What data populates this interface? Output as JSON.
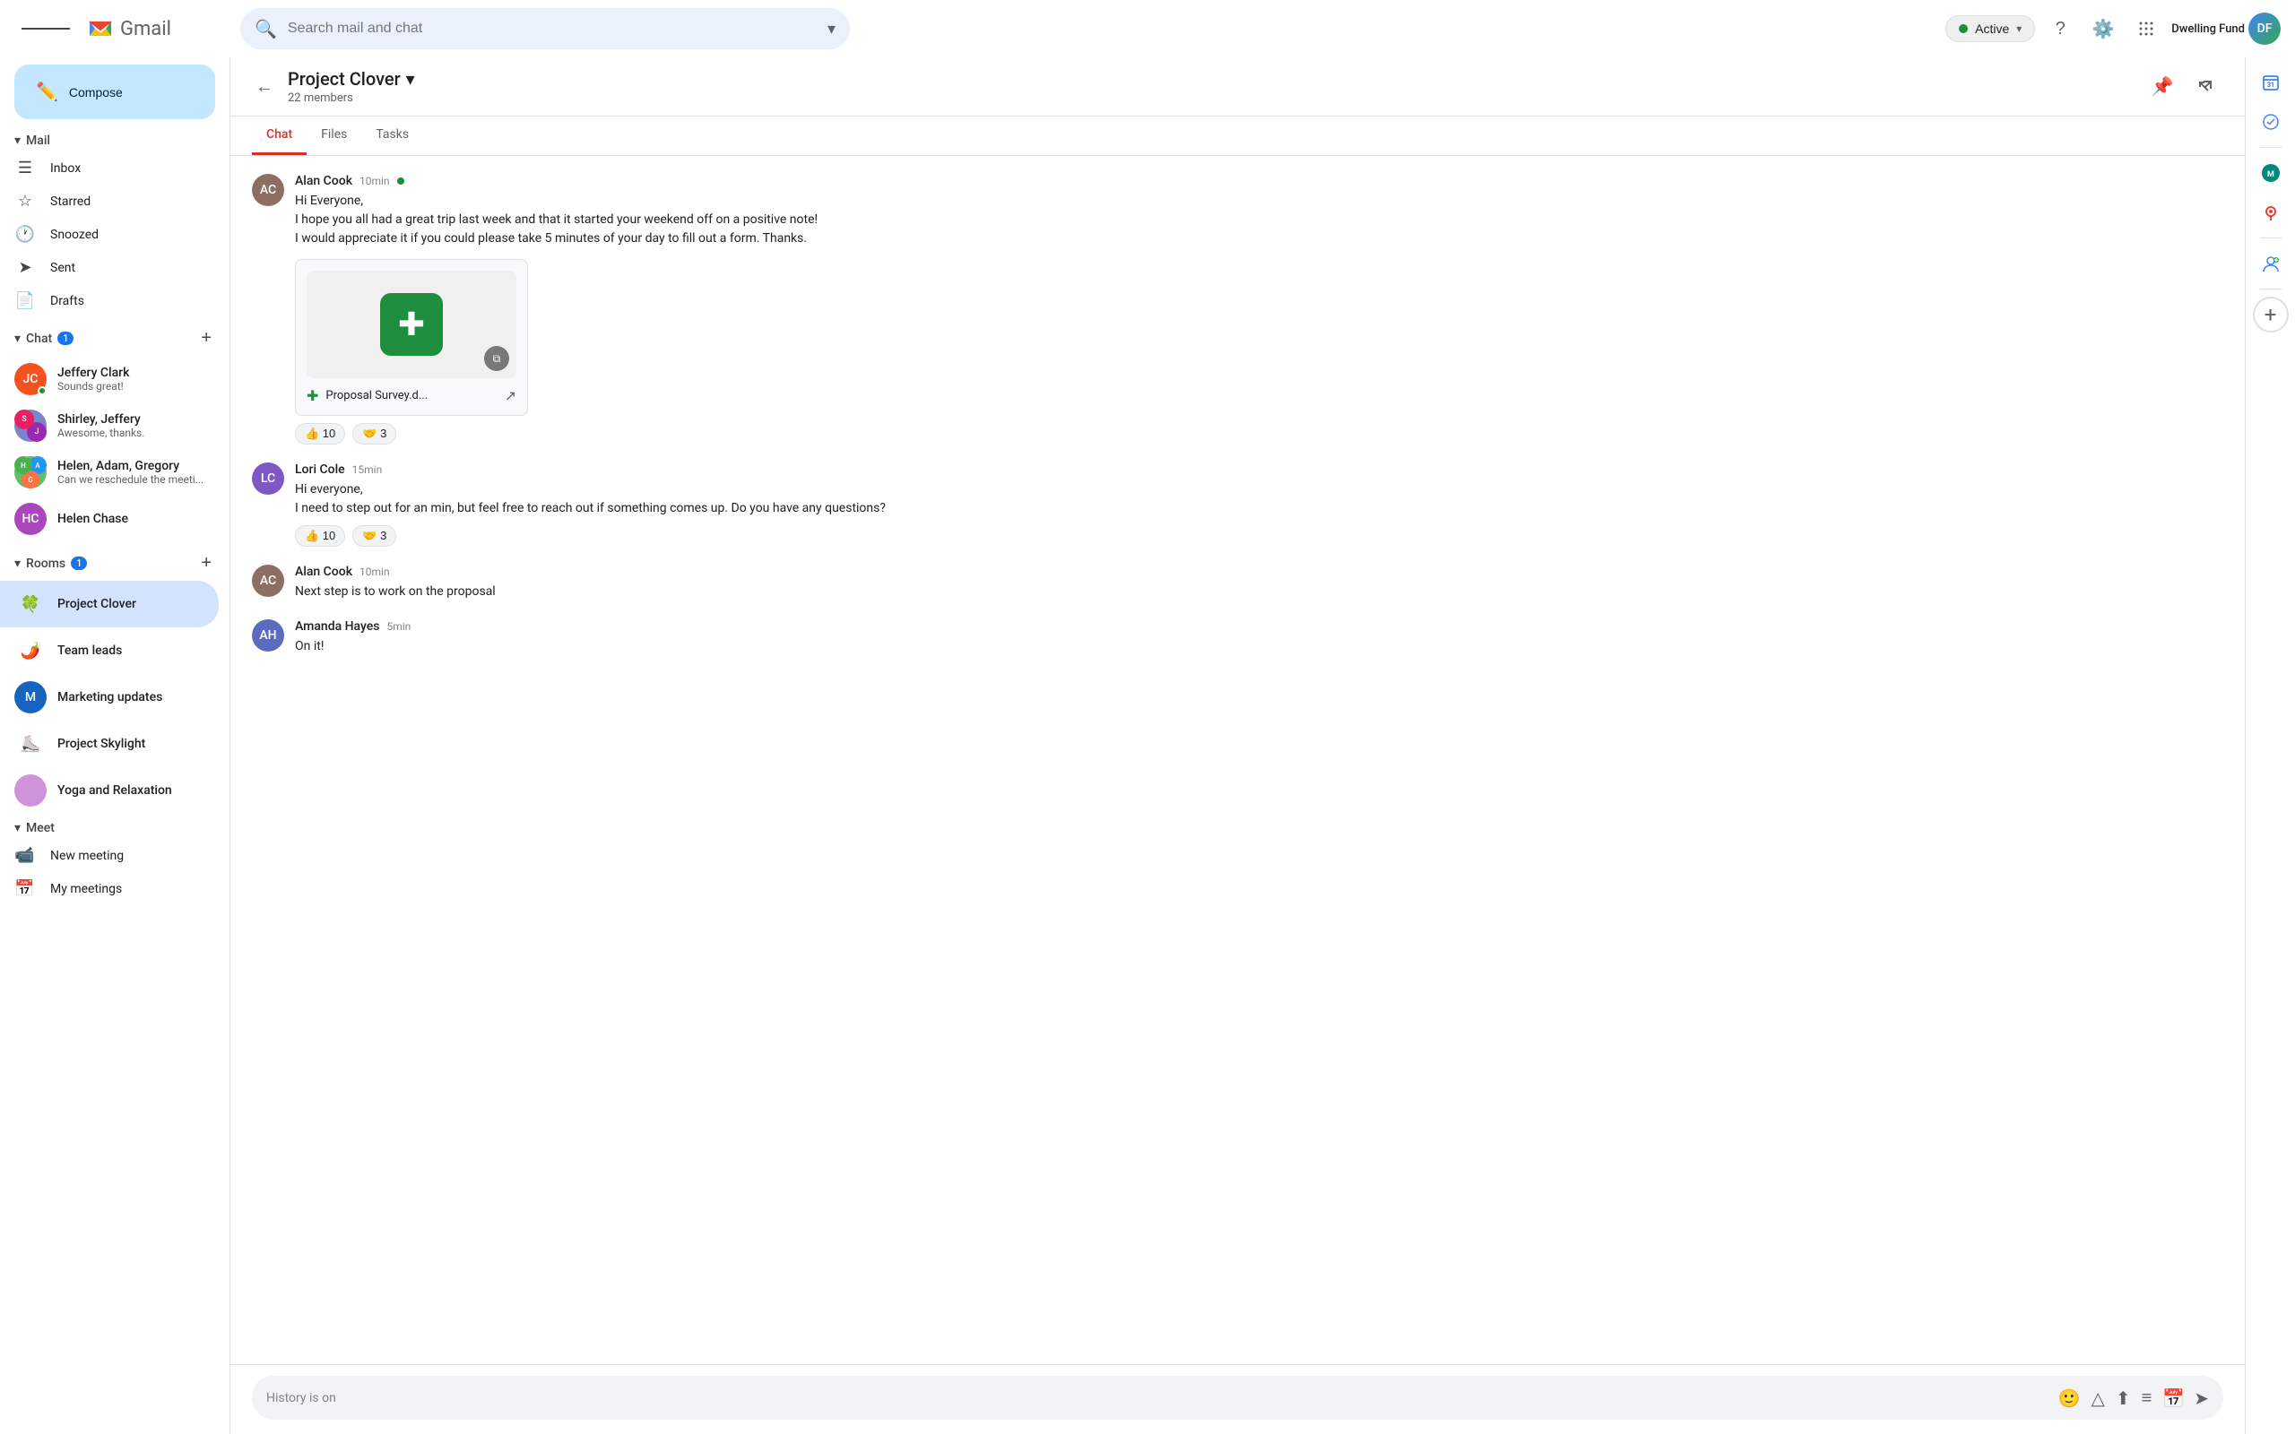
{
  "topbar": {
    "hamburger_label": "Menu",
    "gmail_text": "Gmail",
    "search_placeholder": "Search mail and chat",
    "active_label": "Active",
    "dwelling_fund_label": "Dwelling Fund"
  },
  "sidebar": {
    "compose_label": "Compose",
    "mail_section": "Mail",
    "inbox_label": "Inbox",
    "starred_label": "Starred",
    "snoozed_label": "Snoozed",
    "sent_label": "Sent",
    "drafts_label": "Drafts",
    "chat_section": "Chat",
    "chat_badge": "1",
    "chat_items": [
      {
        "name": "Jeffery Clark",
        "preview": "Sounds great!",
        "online": true
      },
      {
        "name": "Shirley, Jeffery",
        "preview": "Awesome, thanks.",
        "online": false
      },
      {
        "name": "Helen, Adam, Gregory",
        "preview": "Can we reschedule the meeti...",
        "online": false
      },
      {
        "name": "Helen Chase",
        "preview": "",
        "online": false
      }
    ],
    "rooms_section": "Rooms",
    "rooms_badge": "1",
    "room_items": [
      {
        "name": "Project Clover",
        "icon": "🍀"
      },
      {
        "name": "Team leads",
        "icon": "🌶️"
      },
      {
        "name": "Marketing updates",
        "icon": "M",
        "letter": true
      },
      {
        "name": "Project Skylight",
        "icon": "⛸️"
      },
      {
        "name": "Yoga and Relaxation",
        "icon": "🟣"
      }
    ],
    "meet_section": "Meet",
    "new_meeting_label": "New meeting",
    "my_meetings_label": "My meetings"
  },
  "chat": {
    "title": "Project Clover",
    "members": "22 members",
    "tabs": [
      "Chat",
      "Files",
      "Tasks"
    ],
    "active_tab": "Chat"
  },
  "messages": [
    {
      "id": 1,
      "sender": "Alan Cook",
      "time": "10min",
      "online": true,
      "avatar_initials": "AC",
      "avatar_color": "#9c7e58",
      "lines": [
        "Hi Everyone,",
        "I hope you all had a great trip last week and that it started your weekend off on a positive note!",
        "I would appreciate it if you could please take 5 minutes of your day to fill out a form. Thanks."
      ],
      "has_file": true,
      "file_name": "Proposal Survey.d...",
      "reactions": [
        {
          "emoji": "👍",
          "count": "10"
        },
        {
          "emoji": "🤝",
          "count": "3"
        }
      ]
    },
    {
      "id": 2,
      "sender": "Lori Cole",
      "time": "15min",
      "online": false,
      "avatar_initials": "LC",
      "avatar_color": "#7e57c2",
      "lines": [
        "Hi everyone,",
        "I need to step out for an min, but feel free to reach out if something comes up.  Do you have any questions?"
      ],
      "has_file": false,
      "reactions": [
        {
          "emoji": "👍",
          "count": "10"
        },
        {
          "emoji": "🤝",
          "count": "3"
        }
      ]
    },
    {
      "id": 3,
      "sender": "Alan Cook",
      "time": "10min",
      "online": true,
      "avatar_initials": "AC",
      "avatar_color": "#9c7e58",
      "lines": [
        "Next step is to work on the proposal"
      ],
      "has_file": false,
      "reactions": []
    },
    {
      "id": 4,
      "sender": "Amanda Hayes",
      "time": "5min",
      "online": false,
      "avatar_initials": "AH",
      "avatar_color": "#5c6bc0",
      "lines": [
        "On it!"
      ],
      "has_file": false,
      "reactions": []
    }
  ],
  "input": {
    "placeholder": "History is on"
  },
  "right_sidebar": {
    "icons": [
      "calendar31",
      "tasks",
      "contacts",
      "maps",
      "people"
    ]
  }
}
